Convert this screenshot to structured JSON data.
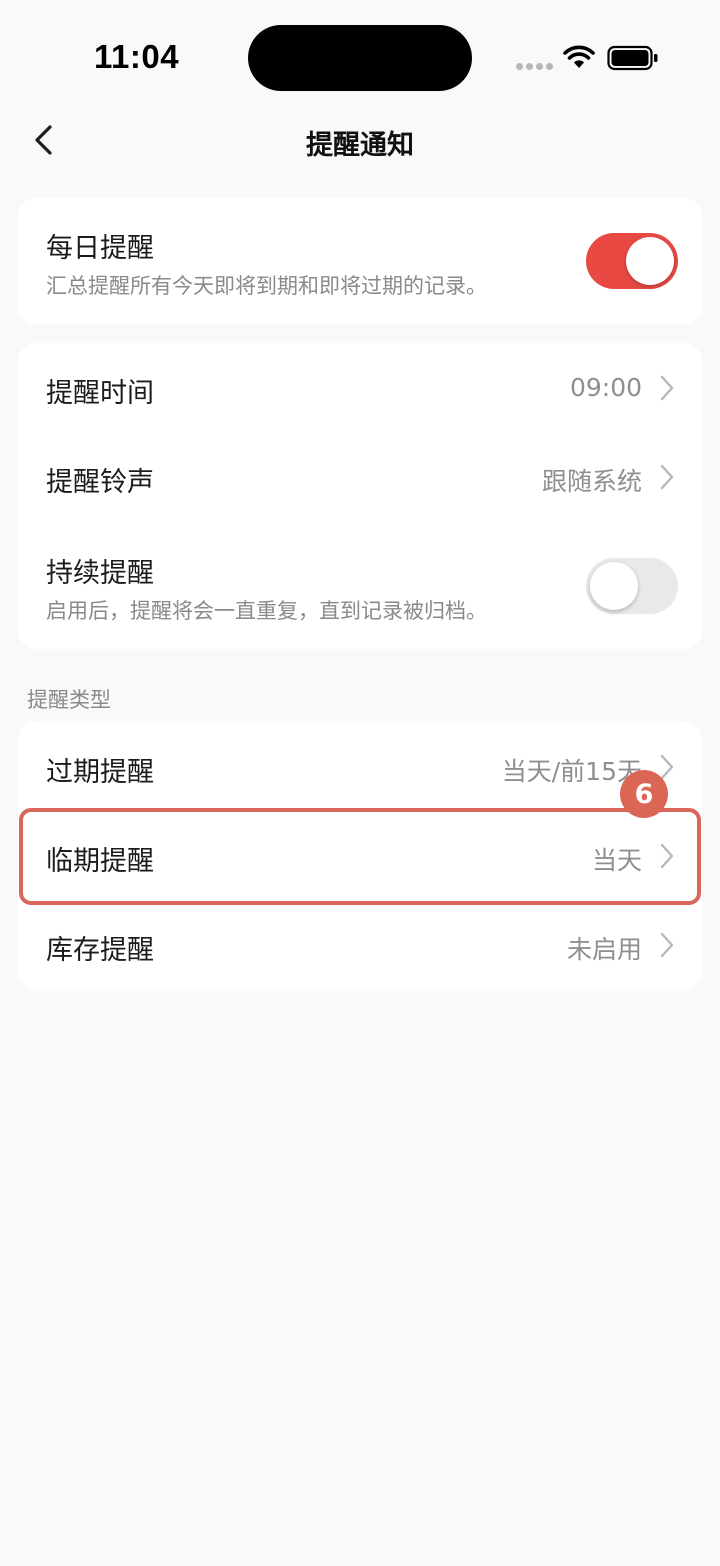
{
  "status_bar": {
    "time": "11:04"
  },
  "nav": {
    "title": "提醒通知"
  },
  "daily": {
    "label": "每日提醒",
    "description": "汇总提醒所有今天即将到期和即将过期的记录。",
    "enabled": true
  },
  "settings": {
    "time": {
      "label": "提醒时间",
      "value": "09:00"
    },
    "sound": {
      "label": "提醒铃声",
      "value": "跟随系统"
    },
    "persistent": {
      "label": "持续提醒",
      "description": "启用后，提醒将会一直重复，直到记录被归档。",
      "enabled": false
    }
  },
  "types": {
    "header": "提醒类型",
    "expired": {
      "label": "过期提醒",
      "value": "当天/前15天"
    },
    "near_expiry": {
      "label": "临期提醒",
      "value": "当天"
    },
    "stock": {
      "label": "库存提醒",
      "value": "未启用"
    }
  },
  "annotation": {
    "step": "6",
    "color": "#d9675a"
  },
  "colors": {
    "accent": "#e84a43",
    "background": "#f9f9f9"
  }
}
